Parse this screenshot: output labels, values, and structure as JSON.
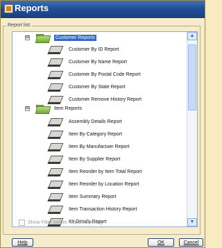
{
  "window": {
    "title": "Reports"
  },
  "group": {
    "label": "Report list:"
  },
  "tree": {
    "categories": [
      {
        "label": "Customer Reports",
        "expander": "⊟"
      },
      {
        "label": "Item Reports",
        "expander": "⊟"
      }
    ],
    "customer_reports": [
      "Customer By ID Report",
      "Customer By Name Report",
      "Customer By Postal Code Report",
      "Customer By State Report",
      "Customer Remove History Report"
    ],
    "item_reports": [
      "Assembly Details Report",
      "Item By Category Report",
      "Item By Manufactuer Report",
      "Item By Supplier Report",
      "Item Reorder by Item Total Report",
      "Item Reorder by Location Report",
      "Item Summary Report",
      "Item Transaction History Report",
      "Kit Details Report"
    ]
  },
  "scrollbar": {
    "up": "▲",
    "down": "▼"
  },
  "options": {
    "show_filter": "Show Filter before Report Opening"
  },
  "buttons": {
    "help": "Help",
    "ok": "OK",
    "cancel": "Cancel"
  }
}
